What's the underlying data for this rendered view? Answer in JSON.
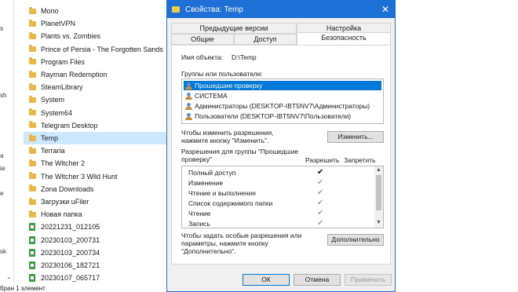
{
  "explorer": {
    "left_strip_chars": [
      "s",
      "sh",
      "a",
      "ia",
      "e",
      "sk"
    ],
    "items": [
      {
        "name": "Mono",
        "type": "folder"
      },
      {
        "name": "PlanetVPN",
        "type": "folder"
      },
      {
        "name": "Plants vs. Zombies",
        "type": "folder"
      },
      {
        "name": "Prince of Persia - The Forgotten Sands",
        "type": "folder"
      },
      {
        "name": "Program Files",
        "type": "folder"
      },
      {
        "name": "Rayman Redemption",
        "type": "folder"
      },
      {
        "name": "SteamLibrary",
        "type": "folder"
      },
      {
        "name": "System",
        "type": "folder"
      },
      {
        "name": "System64",
        "type": "folder"
      },
      {
        "name": "Telegram Desktop",
        "type": "folder"
      },
      {
        "name": "Temp",
        "type": "folder",
        "selected": true
      },
      {
        "name": "Terraria",
        "type": "folder"
      },
      {
        "name": "The Witcher 2",
        "type": "folder"
      },
      {
        "name": "The Witcher 3 Wild Hunt",
        "type": "folder"
      },
      {
        "name": "Zona Downloads",
        "type": "folder"
      },
      {
        "name": "Загрузки uFiler",
        "type": "folder"
      },
      {
        "name": "Новая папка",
        "type": "folder"
      },
      {
        "name": "20221231_012105",
        "type": "file"
      },
      {
        "name": "20230103_200731",
        "type": "file"
      },
      {
        "name": "20230103_200734",
        "type": "file"
      },
      {
        "name": "20230106_182721",
        "type": "file"
      },
      {
        "name": "20230107_065717",
        "type": "file"
      }
    ],
    "status": "бран 1 элемент"
  },
  "dialog": {
    "title": "Свойства: Temp",
    "tabs_top": [
      "Предыдущие версии",
      "Настройка"
    ],
    "tabs_bottom": [
      "Общие",
      "Доступ",
      "Безопасность"
    ],
    "object_label": "Имя объекта:",
    "object_value": "D:\\Temp",
    "groups_label": "Группы или пользователи:",
    "users": [
      {
        "name": "Прошедшие проверку",
        "selected": true
      },
      {
        "name": "СИСТЕМА"
      },
      {
        "name": "Администраторы (DESKTOP-IBT5NV7\\Администраторы)"
      },
      {
        "name": "Пользователи (DESKTOP-IBT5NV7\\Пользователи)"
      }
    ],
    "change_hint": "Чтобы изменить разрешения, нажмите кнопку \"Изменить\".",
    "change_button": "Изменить...",
    "perm_label": "Разрешения для группы \"Прошедшие проверку\"",
    "allow_header": "Разрешить",
    "deny_header": "Запретить",
    "permissions": [
      {
        "name": "Полный доступ",
        "allow": "granted"
      },
      {
        "name": "Изменение",
        "allow": "inherited"
      },
      {
        "name": "Чтение и выполнение",
        "allow": "inherited"
      },
      {
        "name": "Список содержимого папки",
        "allow": "inherited"
      },
      {
        "name": "Чтение",
        "allow": "inherited"
      },
      {
        "name": "Запись",
        "allow": "inherited"
      }
    ],
    "advanced_hint": "Чтобы задать особые разрешения или параметры, нажмите кнопку \"Дополнительно\".",
    "advanced_button": "Дополнительно",
    "ok_button": "ОК",
    "cancel_button": "Отмена",
    "apply_button": "Применить",
    "close_glyph": "✕",
    "check_glyph": "✔",
    "scroll_up_glyph": "▲",
    "scroll_down_glyph": "▼",
    "scroll_down_strip_glyph": "⌄"
  },
  "colors": {
    "title_bar": "#1e6fd6",
    "selection": "#0078d7",
    "explorer_selection": "#cce8ff"
  }
}
